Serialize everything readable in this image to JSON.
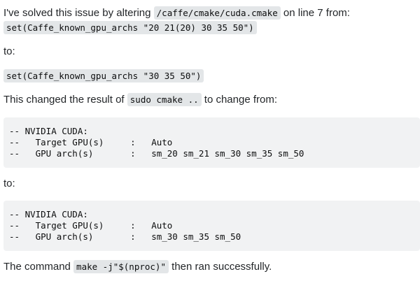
{
  "intro": {
    "prefix": "I've solved this issue by altering ",
    "path": "/caffe/cmake/cuda.cmake",
    "suffix": " on line 7 from:"
  },
  "original_line": "set(Caffe_known_gpu_archs \"20 21(20) 30 35 50\")",
  "to_label_1": "to:",
  "new_line": "set(Caffe_known_gpu_archs \"30 35 50\")",
  "changed": {
    "prefix": "This changed the result of ",
    "command": "sudo cmake ..",
    "suffix": " to change from:"
  },
  "before_block": [
    "-- NVIDIA CUDA:",
    "--   Target GPU(s)     :   Auto",
    "--   GPU arch(s)       :   sm_20 sm_21 sm_30 sm_35 sm_50"
  ],
  "to_label_2": "to:",
  "after_block": [
    "-- NVIDIA CUDA:",
    "--   Target GPU(s)     :   Auto",
    "--   GPU arch(s)       :   sm_30 sm_35 sm_50"
  ],
  "final": {
    "prefix": "The command ",
    "command": "make -j\"$(nproc)\"",
    "suffix": " then ran successfully."
  }
}
